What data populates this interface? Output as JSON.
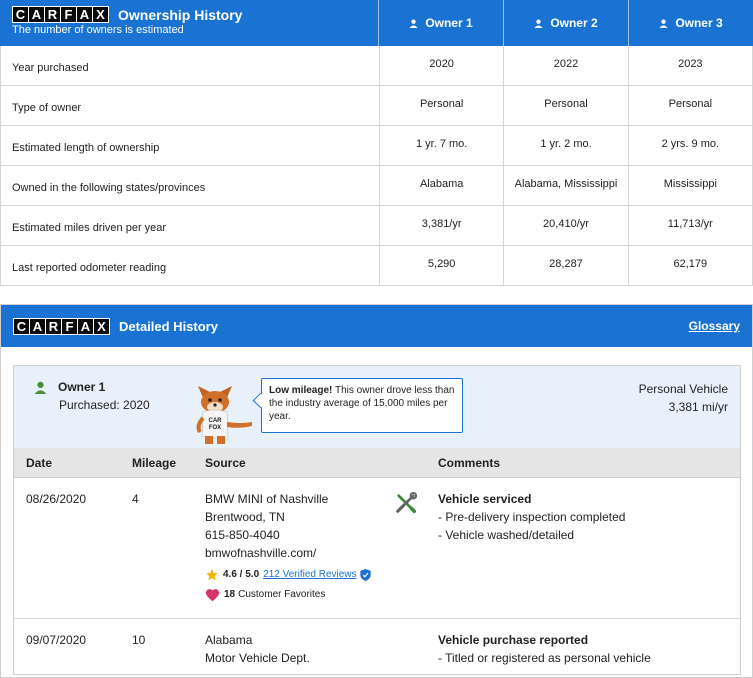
{
  "brand": {
    "letters": [
      "C",
      "A",
      "R",
      "F",
      "A",
      "X"
    ]
  },
  "ownership": {
    "title": "Ownership History",
    "subtitle": "The number of owners is estimated",
    "owners": [
      "Owner 1",
      "Owner 2",
      "Owner 3"
    ],
    "rows": [
      {
        "label": "Year purchased",
        "values": [
          "2020",
          "2022",
          "2023"
        ]
      },
      {
        "label": "Type of owner",
        "values": [
          "Personal",
          "Personal",
          "Personal"
        ]
      },
      {
        "label": "Estimated length of ownership",
        "values": [
          "1 yr. 7 mo.",
          "1 yr. 2 mo.",
          "2 yrs. 9 mo."
        ]
      },
      {
        "label": "Owned in the following states/provinces",
        "values": [
          "Alabama",
          "Alabama, Mississippi",
          "Mississippi"
        ]
      },
      {
        "label": "Estimated miles driven per year",
        "values": [
          "3,381/yr",
          "20,410/yr",
          "11,713/yr"
        ]
      },
      {
        "label": "Last reported odometer reading",
        "values": [
          "5,290",
          "28,287",
          "62,179"
        ]
      }
    ]
  },
  "detailed": {
    "title": "Detailed History",
    "glossary": "Glossary",
    "owner": {
      "name": "Owner 1",
      "purchased": "Purchased: 2020",
      "bubble_bold": "Low mileage!",
      "bubble_text": " This owner drove less than the industry average of 15,000 miles per year.",
      "vehicle_type": "Personal Vehicle",
      "miles": "3,381 mi/yr"
    },
    "columns": {
      "date": "Date",
      "mileage": "Mileage",
      "source": "Source",
      "comments": "Comments"
    },
    "records": [
      {
        "date": "08/26/2020",
        "mileage": "4",
        "source": [
          "BMW MINI of Nashville",
          "Brentwood, TN",
          "615-850-4040",
          "bmwofnashville.com/"
        ],
        "rating": "4.6 / 5.0",
        "reviews": "212 Verified Reviews",
        "favorites_count": "18",
        "favorites_label": "Customer Favorites",
        "comment_title": "Vehicle serviced",
        "comments": [
          "- Pre-delivery inspection completed",
          "- Vehicle washed/detailed"
        ]
      },
      {
        "date": "09/07/2020",
        "mileage": "10",
        "source": [
          "Alabama",
          "Motor Vehicle Dept."
        ],
        "comment_title": "Vehicle purchase reported",
        "comments": [
          "- Titled or registered as personal vehicle"
        ]
      }
    ]
  },
  "colors": {
    "accent": "#1a72d2",
    "owner_bg": "#e8f1fb",
    "header_bg": "#e5e5e5",
    "person_icon": "#4a8c3a",
    "star": "#f4b400",
    "heart": "#d6336c"
  },
  "icons": [
    "person-icon",
    "wrench-screwdriver-icon",
    "star-icon",
    "verified-shield-icon",
    "heart-icon",
    "carfax-fox-mascot"
  ]
}
